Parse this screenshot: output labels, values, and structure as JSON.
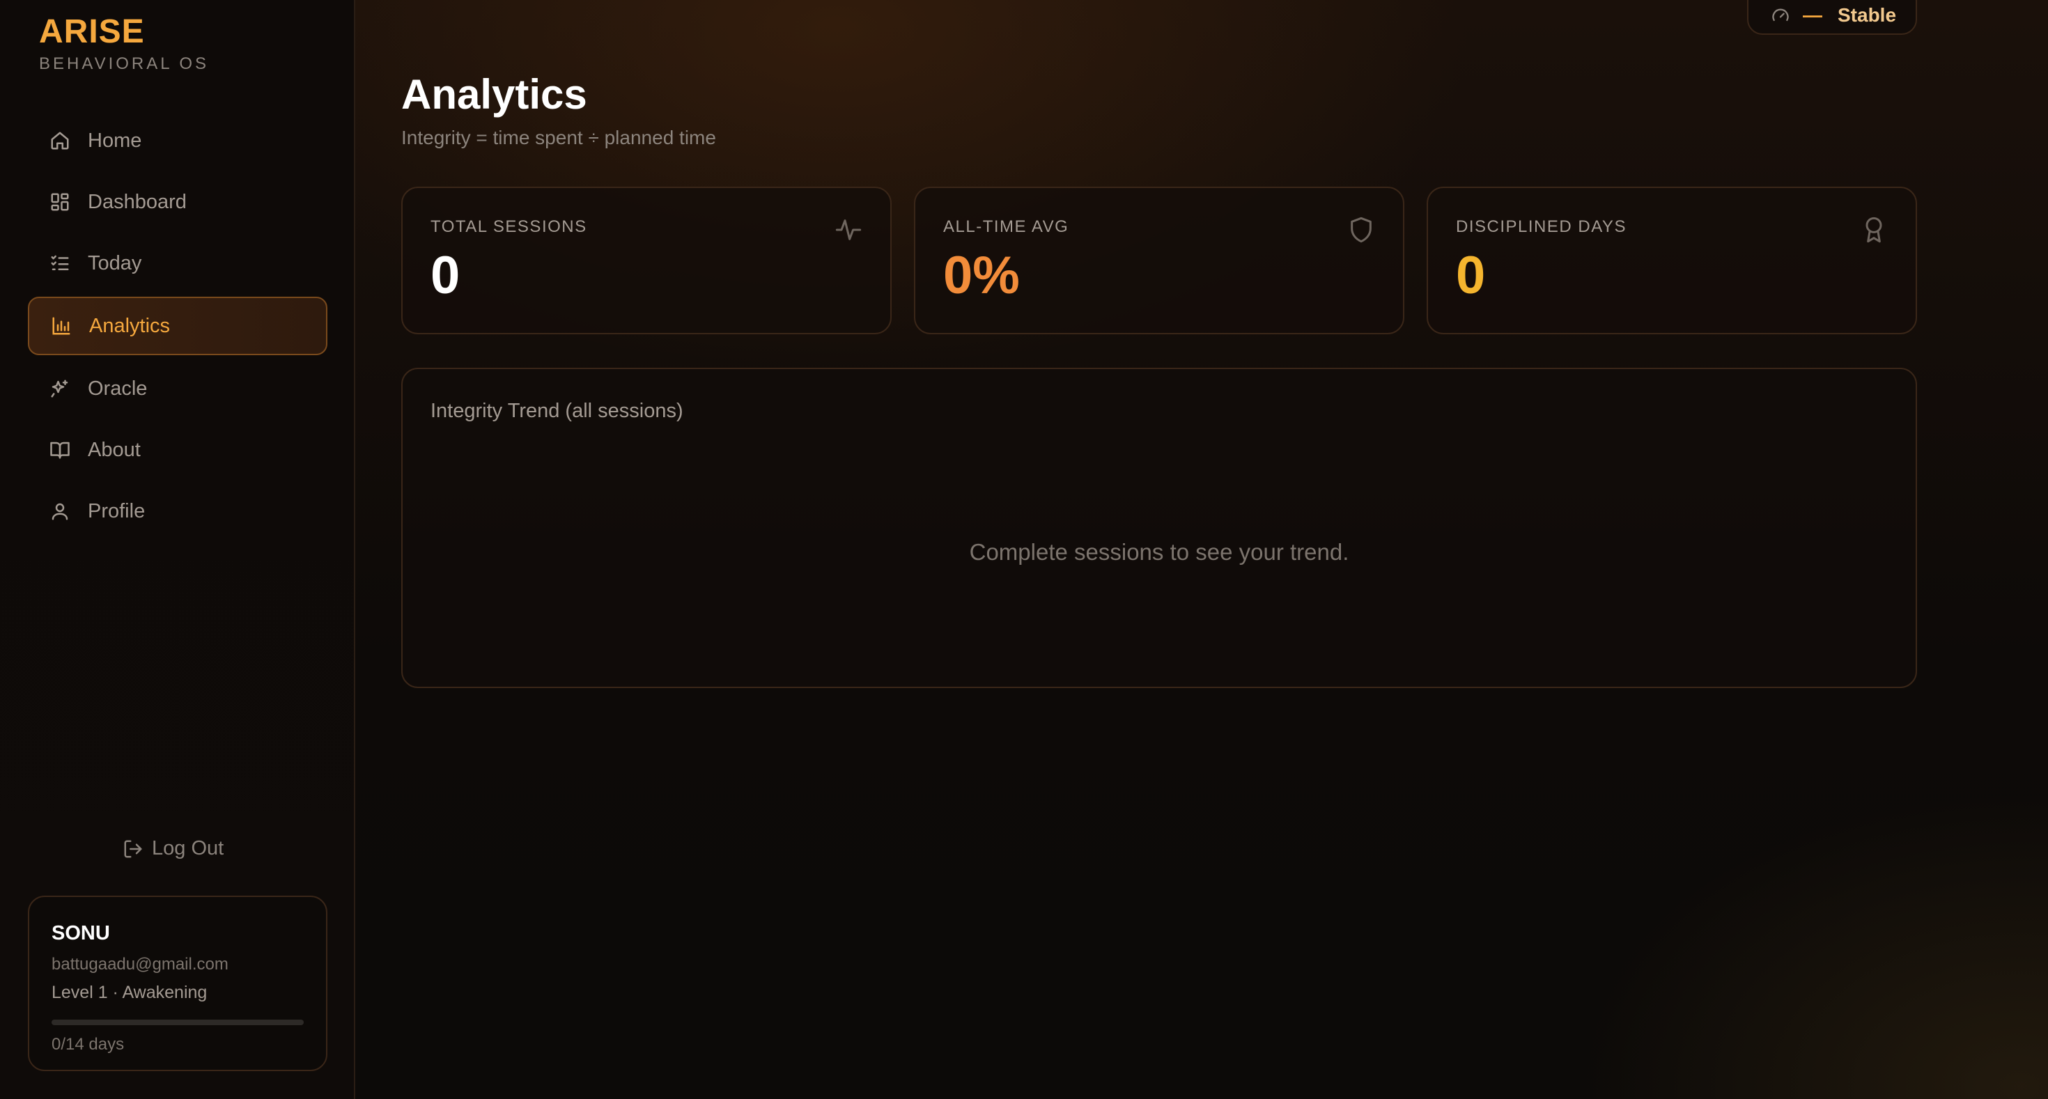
{
  "brand": {
    "title": "ARISE",
    "subtitle": "BEHAVIORAL OS"
  },
  "sidebar": {
    "items": [
      {
        "label": "Home",
        "icon": "home-icon"
      },
      {
        "label": "Dashboard",
        "icon": "dashboard-icon"
      },
      {
        "label": "Today",
        "icon": "checklist-icon"
      },
      {
        "label": "Analytics",
        "icon": "bar-chart-icon",
        "active": true
      },
      {
        "label": "Oracle",
        "icon": "sparkles-icon"
      },
      {
        "label": "About",
        "icon": "book-icon"
      },
      {
        "label": "Profile",
        "icon": "user-icon"
      }
    ],
    "logout_label": "Log Out"
  },
  "user": {
    "name": "SONU",
    "email": "battugaadu@gmail.com",
    "level": "Level 1 · Awakening",
    "days": "0/14 days",
    "progress_fraction": 0
  },
  "status": {
    "dash": "—",
    "label": "Stable",
    "icon": "gauge-icon"
  },
  "page": {
    "title": "Analytics",
    "subtitle": "Integrity = time spent ÷ planned time"
  },
  "stats": [
    {
      "label": "TOTAL SESSIONS",
      "value": "0",
      "icon": "activity-icon",
      "color": "#ffffff"
    },
    {
      "label": "ALL-TIME AVG",
      "value": "0%",
      "icon": "shield-icon",
      "color": "#f28c3a"
    },
    {
      "label": "DISCIPLINED DAYS",
      "value": "0",
      "icon": "award-icon",
      "color": "#f5b52e"
    }
  ],
  "trend": {
    "title": "Integrity Trend (all sessions)",
    "empty_message": "Complete sessions to see your trend."
  },
  "colors": {
    "accent": "#f5a83e",
    "background": "#0c0907",
    "border": "#3a2618"
  }
}
